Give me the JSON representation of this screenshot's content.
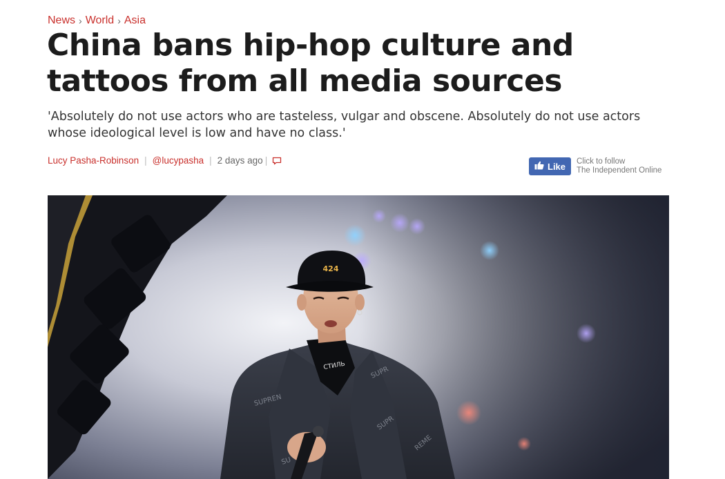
{
  "breadcrumb": {
    "items": [
      "News",
      "World",
      "Asia"
    ],
    "separator": "›"
  },
  "article": {
    "headline": "China bans hip-hop culture and tattoos from all media sources",
    "standfirst": "'Absolutely do not use actors who are tasteless, vulgar and obscene. Absolutely do not use actors whose ideological level is low and have no class.'",
    "author": "Lucy Pasha-Robinson",
    "twitter_handle": "@lucypasha",
    "timestamp": "2 days ago",
    "comment_icon": "comment-bubble-icon"
  },
  "follow_widget": {
    "like_label": "Like",
    "like_icon": "thumbs-up-icon",
    "caption_line1": "Click to follow",
    "caption_line2": "The Independent Online",
    "brand_color": "#4267b2"
  },
  "hero_image": {
    "cap_text": "424",
    "collar_text": "СТИЛЬ"
  },
  "colors": {
    "accent": "#c9302c",
    "headline": "#1c1c1c"
  }
}
